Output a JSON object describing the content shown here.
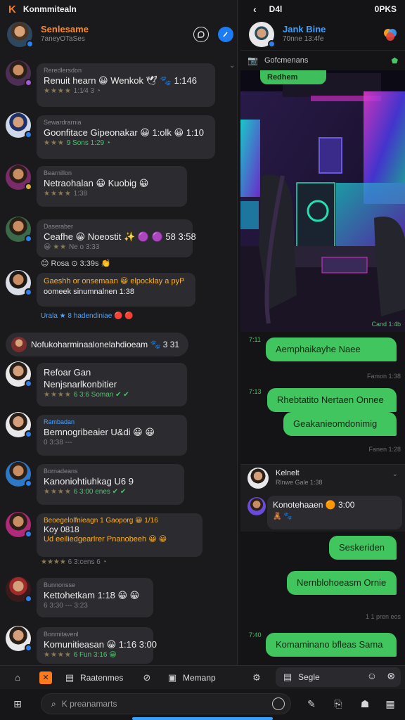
{
  "left_panel": {
    "status": {
      "brand": "K",
      "title": "Konmmitealn"
    },
    "header": {
      "title": "Senlesame",
      "subtitle": "7aneyOTaSes"
    },
    "messages": [
      {
        "meta": "Reredlersdon",
        "body": "Renuit hearn 😀 Wenkok 🕊 🐾 1:146",
        "stars": "1:1⁄4 3 ◔"
      },
      {
        "meta": "Sewardrarnia",
        "body": "Goonfitace Gipeonakar 😀 1:olk 😀 1:10",
        "stars": "9 Sons 1:29 ◔"
      },
      {
        "meta": "Bearnillon",
        "body": "Netraohalan 😀 Kuobig 😀",
        "stars": "1:38"
      },
      {
        "meta": "Daseraber",
        "body": "Ceafhe 😀 Noeostit ✨ 🟣 🟣 58 3:58",
        "stars": "Ne o 3:33"
      },
      {
        "meta": "",
        "body": "Gaeshh or onsemaan 😀 elpocklay a pyP",
        "body2": "oomeek sinumnalnen 1:38",
        "stars": ""
      },
      {
        "meta": "",
        "body": "Refoar Gan",
        "body2": "Nenjsnarlkonbitier",
        "stars": "6 3:6 Soman ✔ ✔"
      },
      {
        "meta": "Rambadan",
        "body": "Bemnogribeaier U&di 😀 😀",
        "stars": "0 3:38 ---"
      },
      {
        "meta": "Bornadeans",
        "body": "Kanoniohtiuhkag U6 9",
        "stars": "6 3:00 enes ✔ ✔"
      },
      {
        "meta": "Beoegelolfnieagn 1 Gaoporg 😀 1/16",
        "body": "Koy 0818",
        "body2": "Ud eeiliedgearlrer Pnanobeeh 😀 😀",
        "stars": "6 3:cens 6 ◔"
      },
      {
        "meta": "Bunnonsse",
        "body": "Kettohetkam 1:18 😀 😀",
        "stars": "6 3:30 --- 3:23"
      },
      {
        "meta": "Bonmitavenl",
        "body": "Komunitieasan 😀 1:16 3:00",
        "stars": "6 Fun 3:16 😀"
      }
    ],
    "reaction_row_1": "😊 Rosa   ⊙ 3:39s 👏",
    "link_row": "Urala ★ 8 hadendiniae 🔴 🔴",
    "mention": "Nofukoharminaalonelahdioeam 🐾 3 31"
  },
  "right_panel": {
    "status": {
      "title": "D4l",
      "right": "0PKS"
    },
    "header": {
      "title": "Jank Bine",
      "subtitle": "70nne 13:4fe"
    },
    "sub_header": "Gofcmenans",
    "pill": "Redhem",
    "photo_caption": "Cand 1:4b",
    "outgoing": [
      {
        "text": "Aemphaikayhe Naee",
        "time": "7:11"
      },
      {
        "text": "Rhebtatito Nertaen Onnee",
        "time": "7:13"
      },
      {
        "text": "Geakanieomdonimig",
        "time": ""
      },
      {
        "text": "Seskeriden",
        "time": ""
      },
      {
        "text": "Nernblohoeasm Ornie",
        "time": ""
      },
      {
        "text": "Komaminano bfleas Sama",
        "time": "7:40"
      }
    ],
    "timestamps": [
      "Famon 1:38",
      "Fanen 1:28",
      "1 1 pren eos"
    ],
    "incoming": {
      "name": "Kelnelt",
      "sub": "Rlnwe Gale 1:38",
      "text": "Konotehaaen 🟠 3:00",
      "reactions": "🧸 🐾"
    }
  },
  "tabbar": {
    "left_tabs": [
      "Raatenmes",
      "Memanp"
    ],
    "right_tab": "Segle"
  },
  "search": {
    "placeholder": "K preanamarts"
  },
  "colors": {
    "accent": "#41c55e",
    "brand": "#ff7a1a",
    "link": "#3aa0ff"
  }
}
